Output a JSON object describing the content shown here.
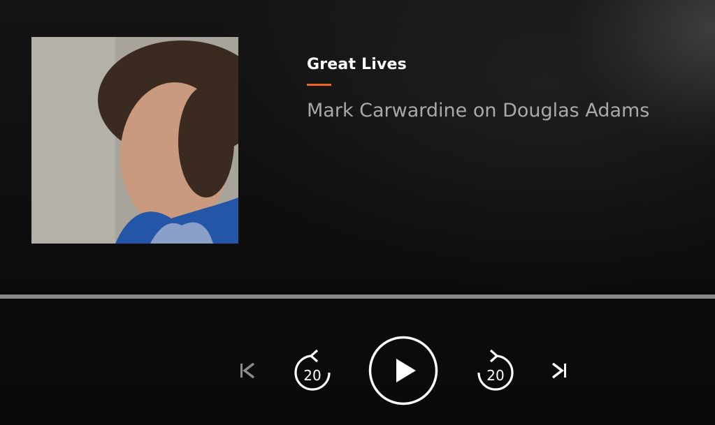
{
  "episode": {
    "show_title": "Great Lives",
    "episode_title": "Mark Carwardine on Douglas Adams",
    "accent_color": "#f26522"
  },
  "artwork": {
    "icon": "episode-artwork-photo"
  },
  "progress": {
    "fraction": 0.0
  },
  "controls": {
    "previous": {
      "icon": "skip-previous-icon"
    },
    "rewind": {
      "icon": "rewind-icon",
      "seconds": "20"
    },
    "play": {
      "icon": "play-icon"
    },
    "forward": {
      "icon": "forward-icon",
      "seconds": "20"
    },
    "next": {
      "icon": "skip-next-icon"
    }
  }
}
